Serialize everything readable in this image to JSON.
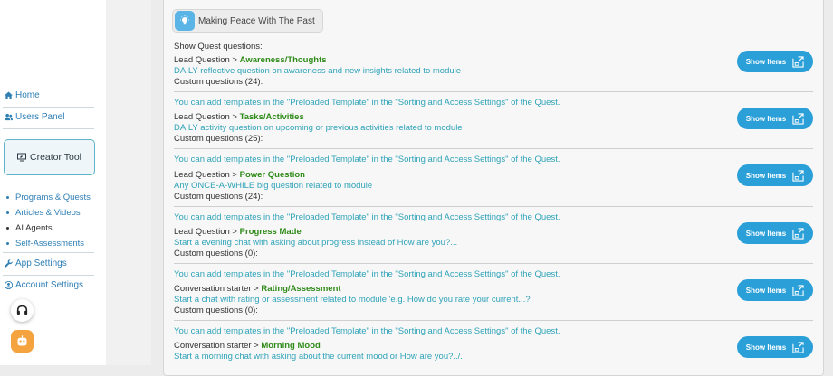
{
  "sidebar": {
    "home": "Home",
    "users_panel": "Users Panel",
    "creator_tool": "Creator Tool",
    "sub_items": [
      {
        "label": "Programs & Quests"
      },
      {
        "label": "Articles & Videos"
      },
      {
        "label": "AI Agents"
      },
      {
        "label": "Self-Assessments"
      }
    ],
    "app_settings": "App Settings",
    "account_settings": "Account Settings"
  },
  "module": {
    "title": "Making Peace With The Past"
  },
  "show_quest_label": "Show Quest questions:",
  "template_hint": "You can add templates in the \"Preloaded Template\" in the \"Sorting and Access Settings\" of the Quest.",
  "show_items_label": "Show Items",
  "questions": [
    {
      "type": "Lead Question > ",
      "name": "Awareness/Thoughts",
      "description": "DAILY reflective question on awareness and new insights related to module",
      "custom": "Custom questions (24):"
    },
    {
      "type": "Lead Question > ",
      "name": "Tasks/Activities",
      "description": "DAILY activity question on upcoming or previous activities related to module",
      "custom": "Custom questions (25):"
    },
    {
      "type": "Lead Question > ",
      "name": "Power Question",
      "description": "Any ONCE-A-WHILE big question related to module",
      "custom": "Custom questions (24):"
    },
    {
      "type": "Lead Question > ",
      "name": "Progress Made",
      "description": "Start a evening chat with asking about progress instead of How are you?...",
      "custom": "Custom questions (0):"
    },
    {
      "type": "Conversation starter > ",
      "name": "Rating/Assessment",
      "description": "Start a chat with rating or assessment related to module 'e.g. How do you rate your current...?'",
      "custom": "Custom questions (0):"
    },
    {
      "type": "Conversation starter > ",
      "name": "Morning Mood",
      "description": "Start a morning chat with asking about the current mood or How are you?../.",
      "custom": ""
    }
  ]
}
